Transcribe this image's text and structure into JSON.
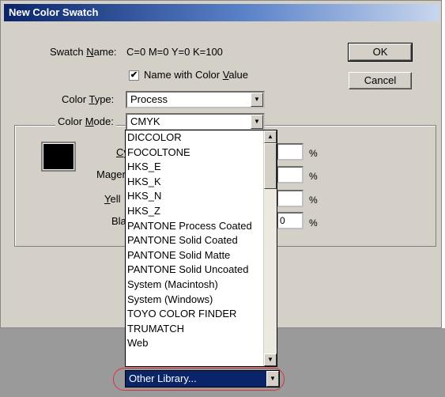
{
  "window": {
    "title": "New Color Swatch"
  },
  "swatch_name": {
    "label_pre": "Swatch ",
    "label_u": "N",
    "label_post": "ame:",
    "value": "C=0 M=0 Y=0 K=100"
  },
  "name_with_value": {
    "check": "✔",
    "label_pre": "Name with Color ",
    "label_u": "V",
    "label_post": "alue"
  },
  "buttons": {
    "ok": "OK",
    "cancel": "Cancel"
  },
  "color_type": {
    "label_pre": "Color ",
    "label_u": "T",
    "label_post": "ype:",
    "value": "Process"
  },
  "color_mode": {
    "label_pre": "Color ",
    "label_u": "M",
    "label_post": "ode:",
    "value": "CMYK"
  },
  "channels": {
    "cyan": {
      "label_u": "C",
      "label_post": "y",
      "value": "",
      "unit": "%"
    },
    "magenta": {
      "label": "Mager",
      "value": "",
      "unit": "%"
    },
    "yellow": {
      "label_u": "Y",
      "label_post": "ell",
      "value": "",
      "unit": "%"
    },
    "black": {
      "label": "Bla",
      "value": "0",
      "unit": "%"
    }
  },
  "dropdown": {
    "options": [
      "DICCOLOR",
      "FOCOLTONE",
      "HKS_E",
      "HKS_K",
      "HKS_N",
      "HKS_Z",
      "PANTONE Process Coated",
      "PANTONE Solid Coated",
      "PANTONE Solid Matte",
      "PANTONE Solid Uncoated",
      "System (Macintosh)",
      "System (Windows)",
      "TOYO COLOR FINDER",
      "TRUMATCH",
      "Web"
    ],
    "selected": "Other Library..."
  },
  "icons": {
    "arrow_down": "▼",
    "arrow_up": "▲"
  },
  "colors": {
    "highlight_oval": "#e03040",
    "selection": "#0a246a"
  }
}
